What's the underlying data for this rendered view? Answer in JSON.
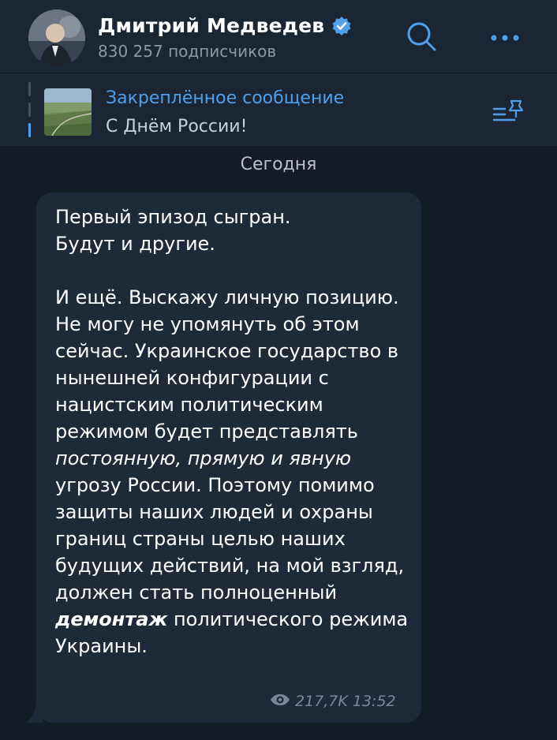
{
  "header": {
    "channel_title": "Дмитрий Медведев",
    "subscribers": "830 257 подписчиков",
    "icons": {
      "avatar": "avatar",
      "verified": "verified-badge-icon",
      "search": "search-icon",
      "more": "more-dots-icon"
    }
  },
  "pinned": {
    "label": "Закреплённое сообщение",
    "text": "С Днём России!",
    "icon": "pinned-list-icon"
  },
  "date_separator": "Сегодня",
  "message": {
    "line1": "Первый эпизод сыгран.",
    "line2": "Будут и другие.",
    "p2_a": "И ещё. Выскажу личную позицию. Не могу не упомянуть об этом сейчас. Украинское государство в нынешней конфигурации с нацистским политическим режимом будет представлять ",
    "p2_italic": "постоянную, прямую и явную",
    "p2_b": " угрозу России. Поэтому помимо защиты наших людей и охраны границ страны целью наших будущих действий, на мой взгляд, должен стать полноценный ",
    "p2_bold": "демонтаж",
    "p2_c": " политического режима Украины.",
    "views": "217,7K",
    "time": "13:52"
  },
  "colors": {
    "background": "#121b26",
    "header": "#1b2634",
    "bubble": "#1e2a3a",
    "accent": "#4f9fea",
    "muted": "#8b98a8"
  }
}
